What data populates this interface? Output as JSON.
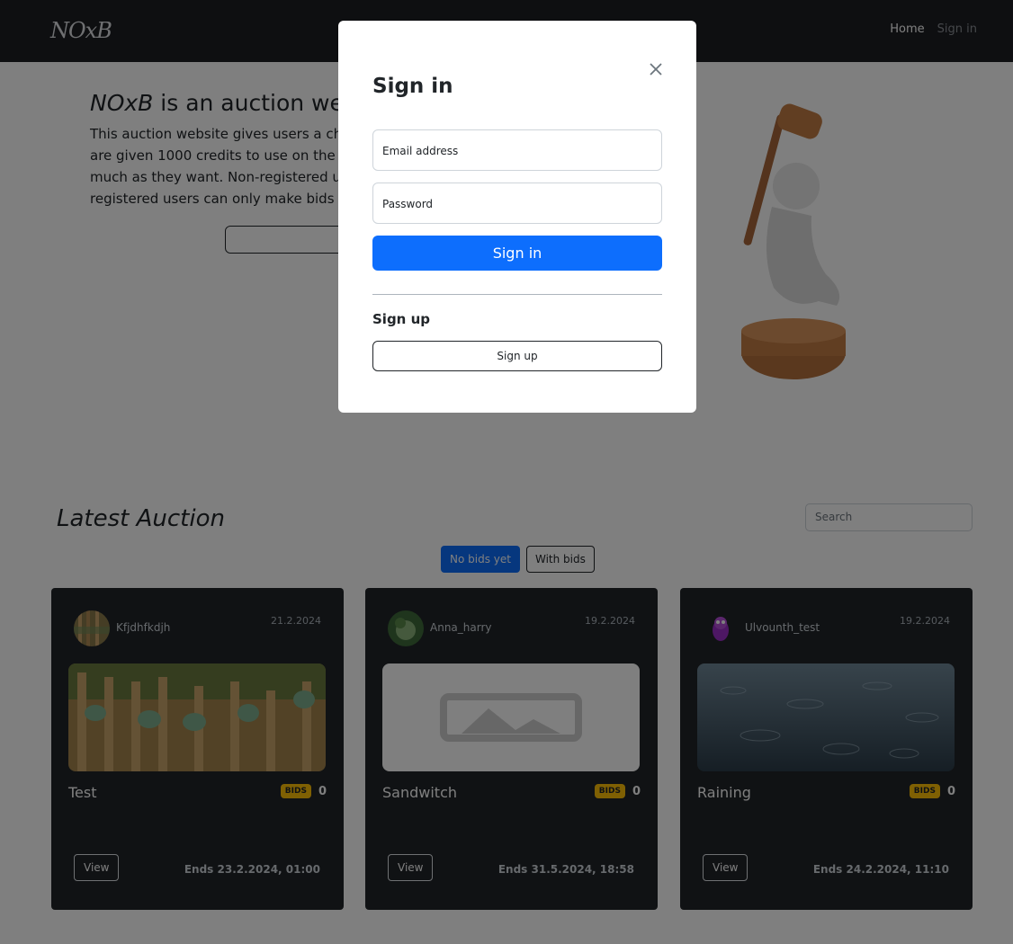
{
  "navbar": {
    "brand": "NOxB",
    "links": {
      "home": "Home",
      "signin": "Sign in"
    }
  },
  "hero": {
    "brand_italic": "NOxB",
    "title_rest": " is an auction website",
    "description": "This auction website gives users a chance to buy and sell items. Registered users are given 1000 credits to use on the site, but they can bid on as many items and as much as they want. Non-registered users can only view auctions and items, while registered users can only make bids on items."
  },
  "latest": {
    "title": "Latest Auction",
    "search_placeholder": "Search",
    "filters": {
      "no_bids": "No bids yet",
      "with_bids": "With bids"
    }
  },
  "cards": [
    {
      "user": "Kfjdhfkdjh",
      "date": "21.2.2024",
      "title": "Test",
      "badge": "BIDS",
      "bids": "0",
      "view": "View",
      "ends": "Ends 23.2.2024, 01:00"
    },
    {
      "user": "Anna_harry",
      "date": "19.2.2024",
      "title": "Sandwitch",
      "badge": "BIDS",
      "bids": "0",
      "view": "View",
      "ends": "Ends 31.5.2024, 18:58"
    },
    {
      "user": "Ulvounth_test",
      "date": "19.2.2024",
      "title": "Raining",
      "badge": "BIDS",
      "bids": "0",
      "view": "View",
      "ends": "Ends 24.2.2024, 11:10"
    }
  ],
  "modal": {
    "title": "Sign in",
    "email_label": "Email address",
    "password_label": "Password",
    "signin_button": "Sign in",
    "signup_heading": "Sign up",
    "signup_button": "Sign up"
  },
  "colors": {
    "primary": "#0d6efd",
    "navbar": "#1d1f23",
    "card": "#212529",
    "badge": "#ffc107"
  }
}
